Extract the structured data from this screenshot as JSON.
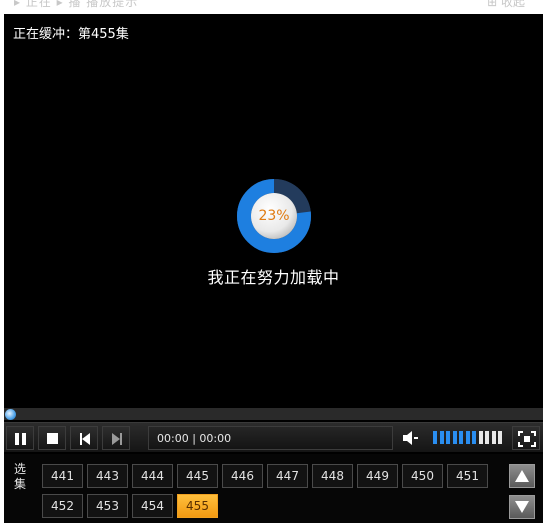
{
  "top_strip": {
    "left_text": "▸ 正在 ▸ 播 播放提示",
    "right_text": "⊞ 收起"
  },
  "player": {
    "buffer_status": "正在缓冲：第455集",
    "loading_percent": "23%",
    "loading_percent_value": 0.23,
    "loading_message": "我正在努力加载中",
    "playback_progress": 0.0,
    "time_display": "00:00 | 00:00",
    "volume_level": 0.6,
    "volume_bars_total": 11
  },
  "episodes": {
    "label": "选集",
    "row1": [
      "441",
      "443",
      "444",
      "445",
      "446",
      "447",
      "448",
      "449",
      "450",
      "451"
    ],
    "row2": [
      "452",
      "453",
      "454",
      "455"
    ],
    "current": "455"
  },
  "icons": [
    "pause-icon",
    "stop-icon",
    "previous-icon",
    "next-icon",
    "volume-icon",
    "fullscreen-icon",
    "scroll-up-icon",
    "scroll-down-icon"
  ],
  "colors": {
    "accent_blue": "#1f7ad6",
    "active_episode": "#f7a51f",
    "loading_text": "#e07b12"
  }
}
